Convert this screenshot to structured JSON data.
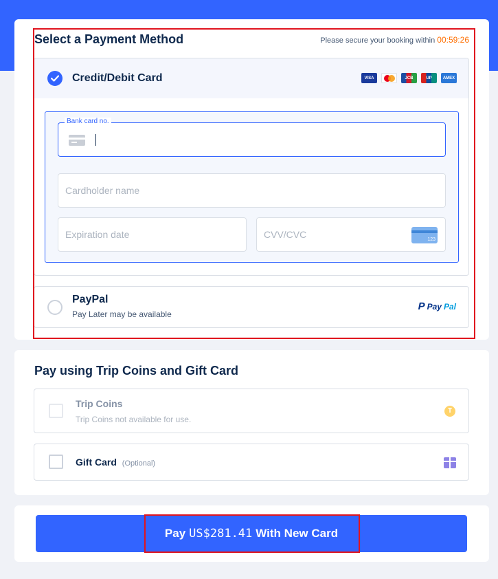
{
  "payment_method": {
    "title": "Select a Payment Method",
    "timer_prefix": "Please secure your booking within",
    "timer_value": "00:59:26",
    "card_option": {
      "label": "Credit/Debit Card",
      "selected": true,
      "logos": [
        {
          "name": "visa-logo-icon",
          "text": "VISA"
        },
        {
          "name": "mastercard-logo-icon",
          "text": ""
        },
        {
          "name": "jcb-logo-icon",
          "text": "JCB"
        },
        {
          "name": "unionpay-logo-icon",
          "text": "UP"
        },
        {
          "name": "amex-logo-icon",
          "text": "AMEX"
        }
      ],
      "bank_card_label": "Bank card no.",
      "bank_card_value": "",
      "cardholder_placeholder": "Cardholder name",
      "expiration_placeholder": "Expiration date",
      "cvv_placeholder": "CVV/CVC",
      "cvv_icon_text": "123"
    },
    "paypal_option": {
      "label": "PayPal",
      "sublabel": "Pay Later may be available",
      "selected": false,
      "logo_text_1": "Pay",
      "logo_text_2": "Pal"
    }
  },
  "coins_gift": {
    "title": "Pay using Trip Coins and Gift Card",
    "trip_coins": {
      "label": "Trip Coins",
      "sublabel": "Trip Coins not available for use.",
      "enabled": false,
      "icon_text": "T"
    },
    "gift_card": {
      "label": "Gift Card",
      "optional_text": "(Optional)"
    }
  },
  "pay": {
    "prefix": "Pay",
    "amount": "US$281.41",
    "suffix": "With New Card"
  },
  "colors": {
    "accent": "#3264ff",
    "timer": "#ff6f00",
    "highlight_frame": "#e0141e",
    "background": "#f0f2f7"
  }
}
